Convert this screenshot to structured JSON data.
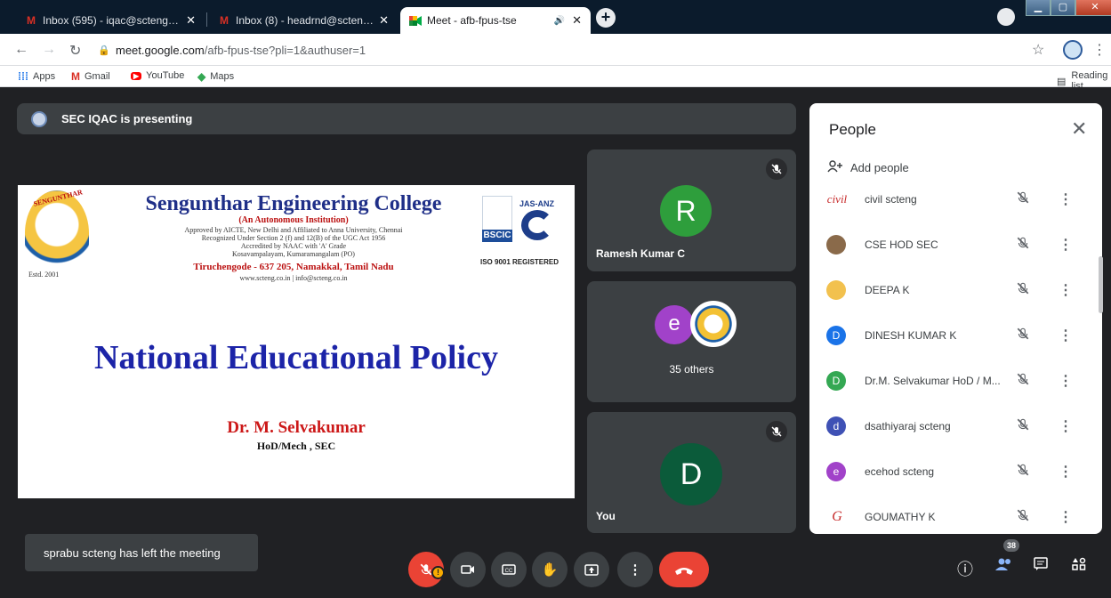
{
  "browser": {
    "tabs": [
      {
        "label": "Inbox (595) - iqac@scteng.co.in -",
        "icon": "gmail-icon"
      },
      {
        "label": "Inbox (8) - headrnd@scteng.co.in",
        "icon": "gmail-icon"
      },
      {
        "label": "Meet - afb-fpus-tse",
        "icon": "meet-icon",
        "active": true
      }
    ],
    "new_tab": "+",
    "url_host": "meet.google.com",
    "url_path": "/afb-fpus-tse?pli=1&authuser=1",
    "bookmarks": [
      "Apps",
      "Gmail",
      "YouTube",
      "Maps"
    ],
    "reading_list": "Reading list"
  },
  "meet": {
    "presenting_banner": "SEC IQAC is presenting",
    "slide": {
      "college": "Sengunthar Engineering College",
      "subtitle": "(An Autonomous Institution)",
      "line1": "Approved by AICTE, New Delhi and Affiliated to Anna University, Chennai",
      "line2": "Recognized Under Section 2 (f) and 12(B) of the UGC Act 1956",
      "line3": "Accredited by NAAC with 'A' Grade",
      "line4": "Kosavampalayam, Kumaramangalam (PO)",
      "address": "Tiruchengode - 637 205, Namakkal, Tamil Nadu",
      "web": "www.scteng.co.in | info@scteng.co.in",
      "emblem": "SENGUNTHAR",
      "estd": "Estd. 2001",
      "bscic": "BSCIC",
      "jas": "JAS-ANZ",
      "iso": "ISO 9001 REGISTERED",
      "title": "National Educational Policy",
      "author": "Dr. M. Selvakumar",
      "role": "HoD/Mech , SEC"
    },
    "tiles": {
      "t1": {
        "name": "Ramesh Kumar C",
        "initial": "R",
        "color": "#2e9e3c"
      },
      "t2": {
        "name": "35 others",
        "initial": "e"
      },
      "t3": {
        "name": "You",
        "initial": "D",
        "color": "#0b5b3a"
      }
    },
    "toast": "sprabu scteng has left the meeting",
    "participant_count": "38",
    "people": {
      "title": "People",
      "add": "Add people",
      "list": [
        {
          "name": "civil scteng",
          "initial": "civil",
          "color": "#ffffff"
        },
        {
          "name": "CSE HOD SEC",
          "initial": "",
          "color": "#8a6a4a"
        },
        {
          "name": "DEEPA K",
          "initial": "",
          "color": "#f2c14e"
        },
        {
          "name": "DINESH KUMAR K",
          "initial": "D",
          "color": "#1a73e8"
        },
        {
          "name": "Dr.M. Selvakumar HoD / M...",
          "initial": "D",
          "color": "#34a853"
        },
        {
          "name": "dsathiyaraj scteng",
          "initial": "d",
          "color": "#3f51b5"
        },
        {
          "name": "ecehod scteng",
          "initial": "e",
          "color": "#a142c9"
        },
        {
          "name": "GOUMATHY K",
          "initial": "G",
          "color": "#ffffff"
        }
      ]
    }
  }
}
